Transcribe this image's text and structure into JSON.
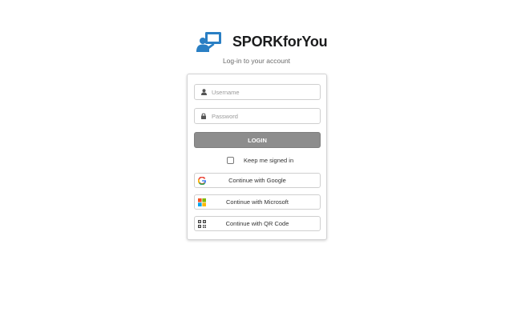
{
  "brand": {
    "name": "SPORKforYou",
    "logo_icon": "presentation-user-icon",
    "accent": "#2a7fc4"
  },
  "subtitle": "Log-in to your account",
  "form": {
    "username": {
      "placeholder": "Username",
      "value": "",
      "icon": "user-icon"
    },
    "password": {
      "placeholder": "Password",
      "value": "",
      "icon": "lock-icon"
    },
    "login_label": "LOGIN",
    "remember_label": "Keep me signed in",
    "remember_checked": false
  },
  "sso": {
    "google": {
      "label": "Continue with Google",
      "icon": "google-icon"
    },
    "microsoft": {
      "label": "Continue with Microsoft",
      "icon": "microsoft-icon"
    },
    "qr": {
      "label": "Continue with QR Code",
      "icon": "qr-code-icon"
    }
  }
}
